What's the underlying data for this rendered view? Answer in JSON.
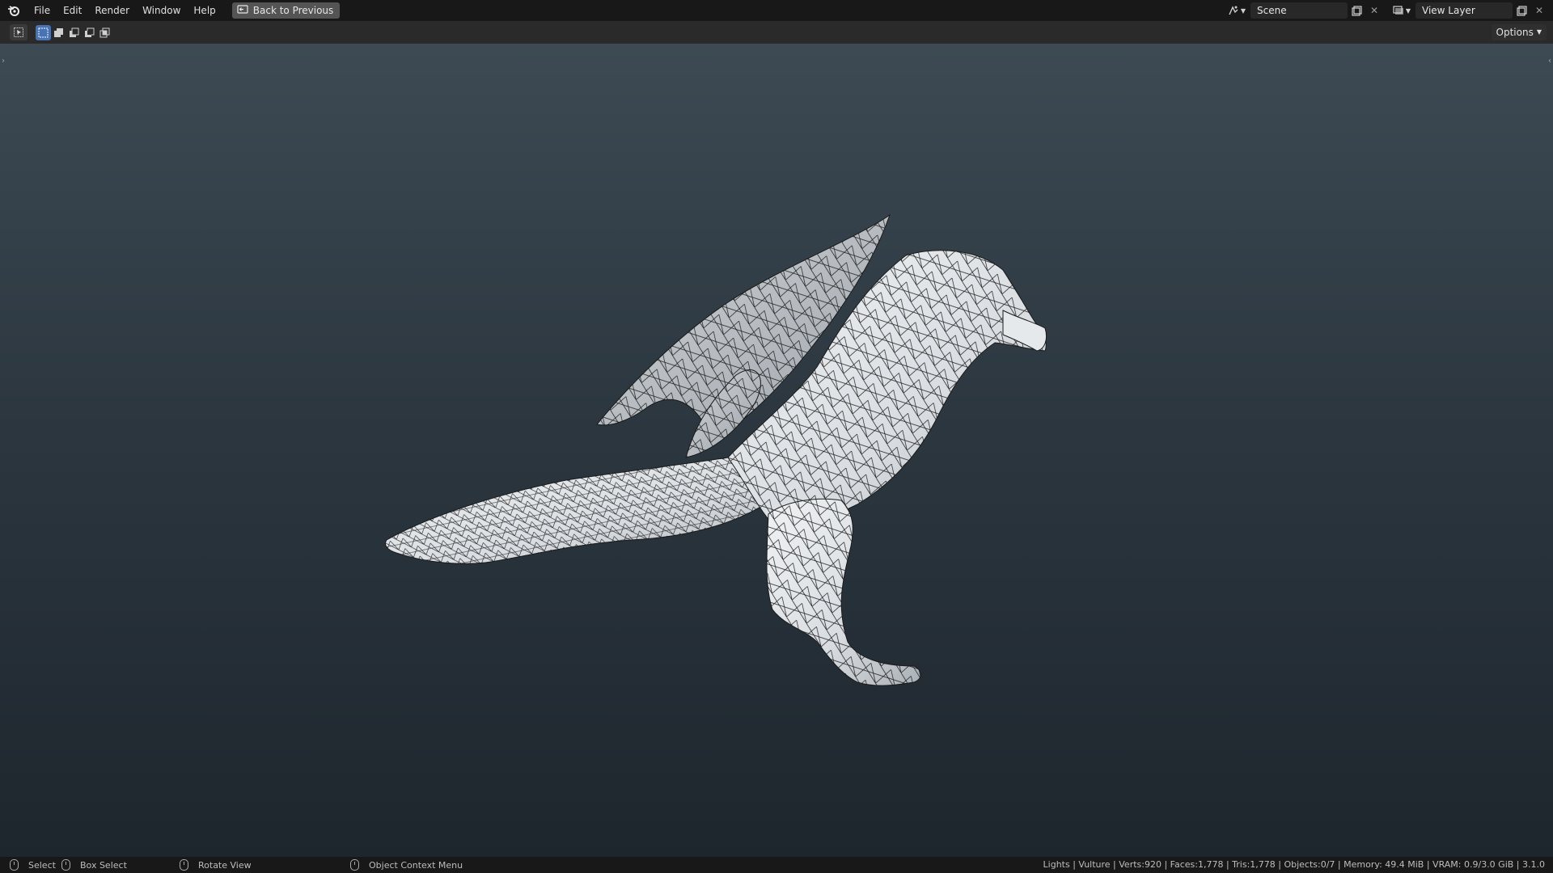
{
  "topbar": {
    "menus": [
      "File",
      "Edit",
      "Render",
      "Window",
      "Help"
    ],
    "back_button": "Back to Previous",
    "scene_name": "Scene",
    "view_layer_name": "View Layer"
  },
  "toolheader": {
    "options_label": "Options"
  },
  "statusbar": {
    "select": "Select",
    "box_select": "Box Select",
    "rotate_view": "Rotate View",
    "context_menu": "Object Context Menu",
    "stats": "Lights | Vulture | Verts:920 | Faces:1,778 | Tris:1,778 | Objects:0/7 | Memory: 49.4 MiB | VRAM: 0.9/3.0 GiB | 3.1.0"
  },
  "colors": {
    "accent": "#4772b3",
    "viewport_top": "#3d4a53",
    "viewport_bottom": "#1e262d",
    "mesh_fill": "#e4e7ea",
    "mesh_wire": "#1a1a1a"
  },
  "icons": [
    "blender-logo-icon",
    "back-icon",
    "scene-icon",
    "view-layer-icon",
    "new-icon",
    "close-icon",
    "cursor-tool-icon",
    "mouse-icon"
  ]
}
